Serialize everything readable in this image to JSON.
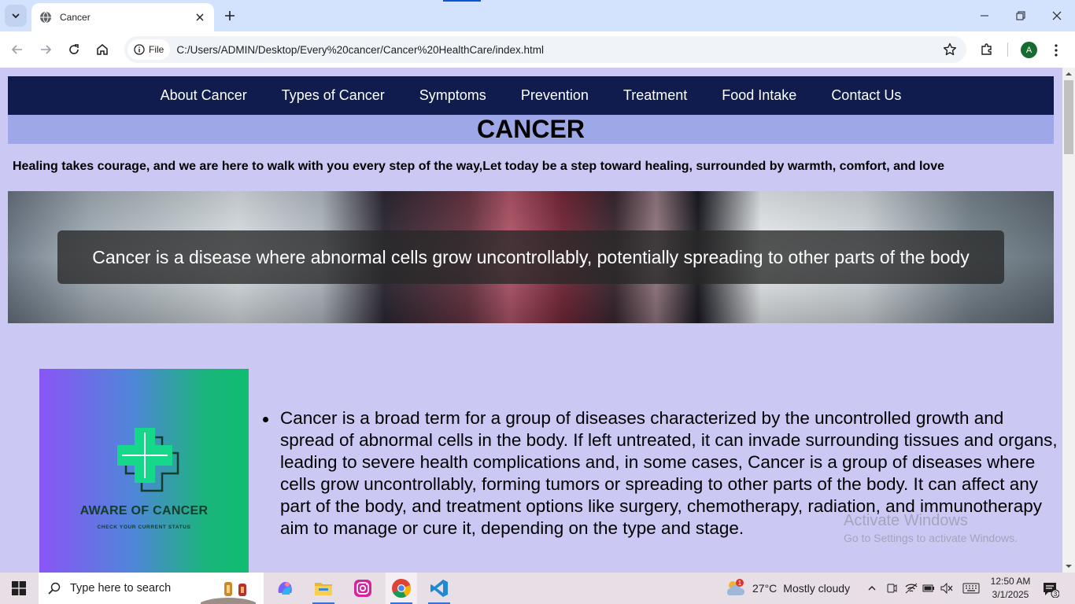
{
  "browser": {
    "tab_title": "Cancer",
    "chip_label": "File",
    "url": "C:/Users/ADMIN/Desktop/Every%20cancer/Cancer%20HealthCare/index.html",
    "profile_initial": "A"
  },
  "site": {
    "nav": [
      "About Cancer",
      "Types of Cancer",
      "Symptoms",
      "Prevention",
      "Treatment",
      "Food Intake",
      "Contact Us"
    ],
    "banner_title": "CANCER",
    "tagline": "Healing takes courage, and we are here to walk with you every step of the way,Let today be a step toward healing, surrounded by warmth, comfort, and love",
    "hero_caption": "Cancer is a disease where abnormal cells grow uncontrollably, potentially spreading to other parts of the body",
    "logo_title": "AWARE OF CANCER",
    "logo_subtitle": "CHECK YOUR CURRENT STATUS",
    "description": "Cancer is a broad term for a group of diseases characterized by the uncontrolled growth and spread of abnormal cells in the body. If left untreated, it can invade surrounding tissues and organs, leading to severe health complications and, in some cases, Cancer is a group of diseases where cells grow uncontrollably, forming tumors or spreading to other parts of the body. It can affect any part of the body, and treatment options like surgery, chemotherapy, radiation, and immunotherapy aim to manage or cure it, depending on the type and stage.",
    "colors": {
      "nav_bg": "#0f1c4d",
      "page_bg": "#cbc8f4",
      "banner_bg": "#9ea8e8"
    }
  },
  "watermark": {
    "title": "Activate Windows",
    "subtitle": "Go to Settings to activate Windows."
  },
  "taskbar": {
    "search_placeholder": "Type here to search",
    "weather_temp": "27°C",
    "weather_desc": "Mostly cloudy",
    "weather_badge": "1",
    "time": "12:50 AM",
    "date": "3/1/2025",
    "notification_count": "3"
  }
}
